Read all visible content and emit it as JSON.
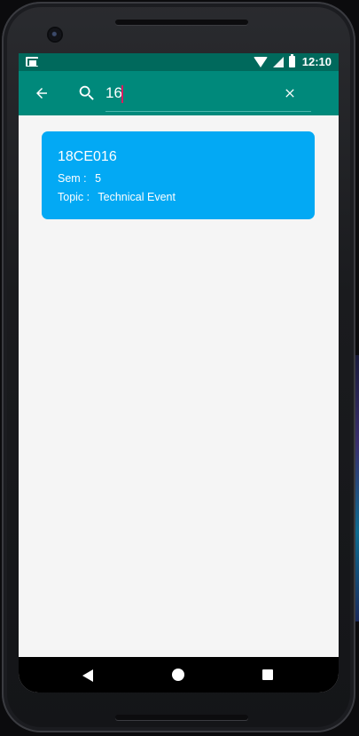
{
  "status_bar": {
    "time": "12:10"
  },
  "appbar": {
    "search": {
      "value": "16",
      "placeholder": ""
    }
  },
  "results": [
    {
      "id": "18CE016",
      "sem_label": "Sem :",
      "sem_value": "5",
      "topic_label": "Topic :",
      "topic_value": "Technical Event"
    }
  ],
  "icons": {
    "back": "arrow-back-icon",
    "search": "search-icon",
    "clear": "close-icon",
    "nav_back": "triangle-back-icon",
    "nav_home": "circle-home-icon",
    "nav_recent": "square-recents-icon"
  },
  "colors": {
    "statusbar": "#00695c",
    "appbar": "#00897b",
    "card": "#03a9f4",
    "caret": "#d81b60",
    "background": "#f5f5f5"
  }
}
